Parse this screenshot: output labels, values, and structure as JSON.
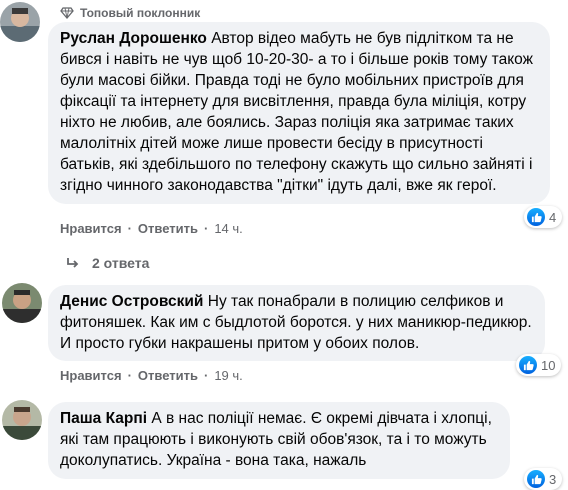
{
  "comments": [
    {
      "badge": "Топовый поклонник",
      "author": "Руслан Дорошенко",
      "text": "Автор відео мабуть не був підлітком та не бився і навіть не чув щоб 10-20-30- а то і більше років тому також були масові бійки. Правда тоді не було мобільних пристроїв для фіксації та інтернету для висвітлення, правда була міліція, котру ніхто не любив, але боялись. Зараз поліція яка затримає таких малолітніх дітей може лише провести бесіду в присутності батьків, які здебільшого по телефону скажуть що сильно зайняті і згідно чинного законодавства \"дітки\" ідуть далі, вже як герої.",
      "like_label": "Нравится",
      "reply_label": "Ответить",
      "time": "14 ч.",
      "reactions": "4",
      "replies_label": "2 ответа"
    },
    {
      "author": "Денис Островский",
      "text": "Ну так понабрали в полицию селфиков и фитоняшек. Как им с быдлотой боротся. у них маникюр-педикюр. И просто губки накрашены притом у обоих полов.",
      "like_label": "Нравится",
      "reply_label": "Ответить",
      "time": "19 ч.",
      "reactions": "10"
    },
    {
      "author": "Паша Карпі",
      "text": "А в нас поліції немає. Є окремі дівчата і хлопці, які там працюють і виконують свій обов'язок, та і то можуть доколупатись. Україна - вона така, нажаль",
      "reactions": "3"
    }
  ],
  "colors": {
    "bubble": "#f0f2f5",
    "secondary_text": "#65676b",
    "like_blue": "#0571ed"
  },
  "icons": {
    "badge": "diamond-icon",
    "like": "thumbs-up-icon",
    "reply_arrow": "reply-arrow-icon"
  }
}
